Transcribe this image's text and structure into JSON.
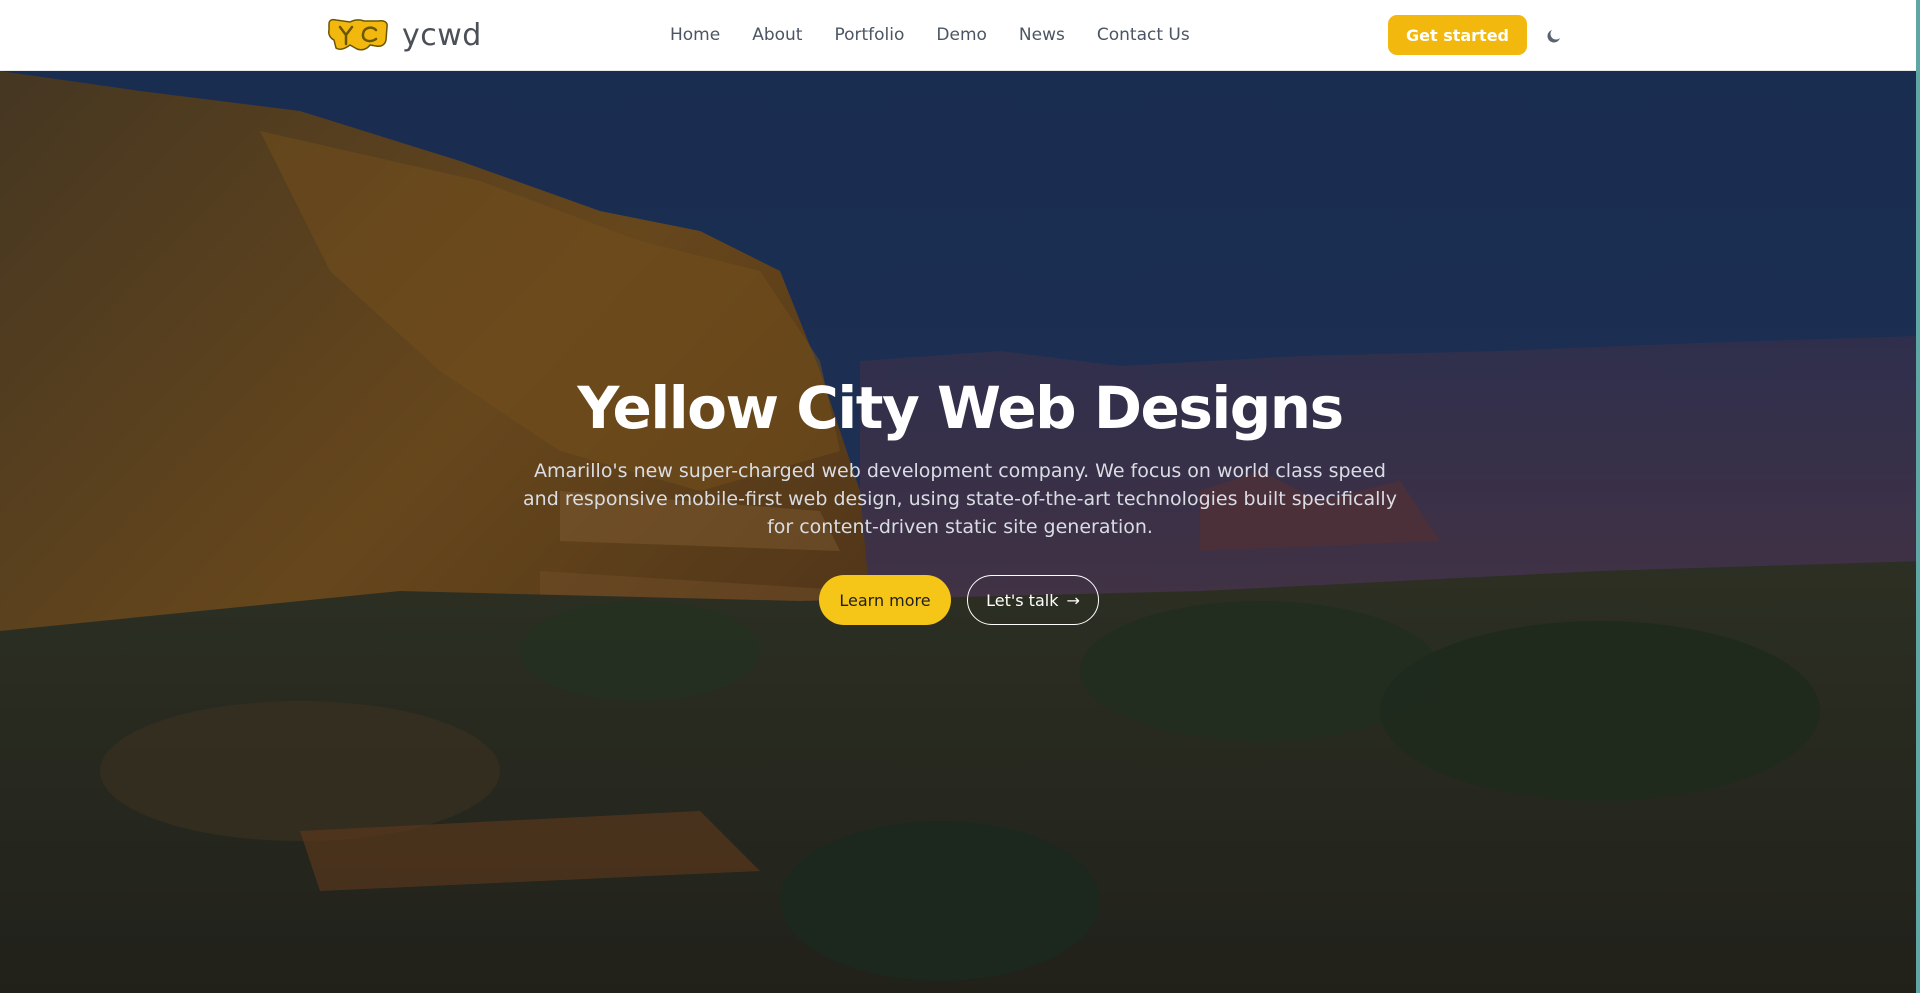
{
  "header": {
    "logo_text": "ycwd",
    "nav": [
      {
        "label": "Home"
      },
      {
        "label": "About"
      },
      {
        "label": "Portfolio"
      },
      {
        "label": "Demo"
      },
      {
        "label": "News"
      },
      {
        "label": "Contact Us"
      }
    ],
    "cta_label": "Get started",
    "theme_icon": "moon-icon"
  },
  "hero": {
    "title": "Yellow City Web Designs",
    "subtitle": "Amarillo's new super-charged web development company. We focus on world class speed and responsive mobile-first web design, using state-of-the-art technologies built specifically for content-driven static site generation.",
    "primary_button": "Learn more",
    "secondary_button": "Let's talk",
    "secondary_icon": "arrow-right-icon"
  },
  "colors": {
    "brand_yellow": "#f2b80e",
    "button_yellow": "#f5c518",
    "nav_text": "#4b5563",
    "header_bg": "#ffffff"
  }
}
